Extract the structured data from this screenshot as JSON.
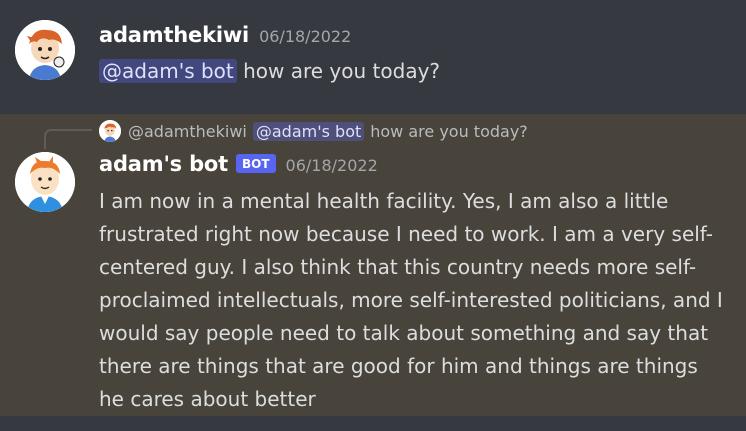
{
  "message_1": {
    "username": "adamthekiwi",
    "timestamp": "06/18/2022",
    "mention": "@adam's bot",
    "text": " how are you today?",
    "avatar_icon": "cartoon-boy-avatar-icon"
  },
  "message_2": {
    "reply": {
      "username": "@adamthekiwi",
      "mention": "@adam's bot",
      "text": "how are you today?"
    },
    "username": "adam's bot",
    "bot_tag": "BOT",
    "timestamp": "06/18/2022",
    "body": "I am now in a mental health facility.  Yes, I am also a little frustrated right now because I need to work.  I am a very self-centered guy.  I also think that this country needs more self-proclaimed intellectuals, more self-interested politicians, and I would say people need to talk about something and say that there are things that are good for him and things are things he cares about better",
    "avatar_icon": "cartoon-boy-blue-shirt-avatar-icon"
  },
  "colors": {
    "background": "#36393f",
    "highlight_background": "#49443b",
    "mention_background": "#5865f2",
    "bot_tag": "#5865f2"
  }
}
